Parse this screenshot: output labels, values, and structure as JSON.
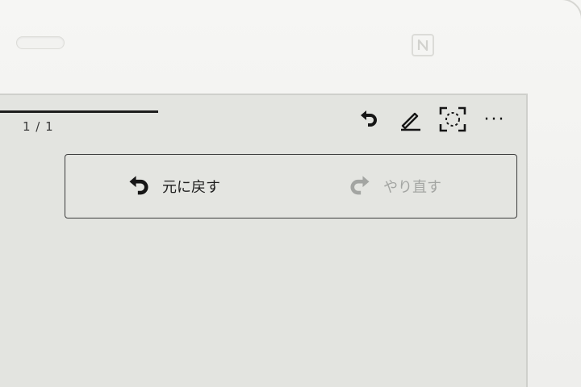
{
  "status": {
    "page_counter": "1 / 1",
    "page_progress_fraction": 0.3
  },
  "toolbar": {
    "icons": [
      "undo-icon",
      "pen-icon",
      "screenshot-frame-icon",
      "more-icon"
    ],
    "more_glyph": "···"
  },
  "edit_menu": {
    "undo_label": "元に戻す",
    "redo_label": "やり直す",
    "redo_enabled": false
  },
  "colors": {
    "screen": "#e3e4e0",
    "ink": "#1e1e1e",
    "disabled": "#a3a5a2"
  }
}
